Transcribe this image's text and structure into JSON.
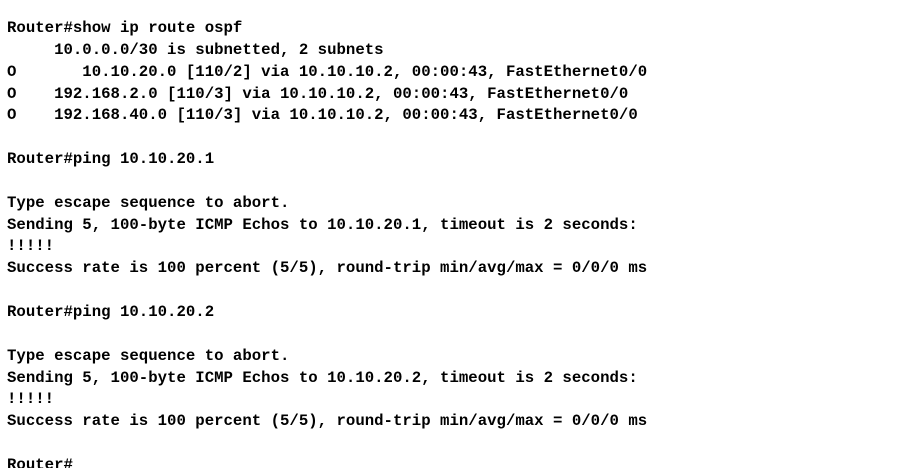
{
  "terminal": {
    "lines": [
      "Router#show ip route ospf",
      "     10.0.0.0/30 is subnetted, 2 subnets",
      "O       10.10.20.0 [110/2] via 10.10.10.2, 00:00:43, FastEthernet0/0",
      "O    192.168.2.0 [110/3] via 10.10.10.2, 00:00:43, FastEthernet0/0",
      "O    192.168.40.0 [110/3] via 10.10.10.2, 00:00:43, FastEthernet0/0",
      "",
      "Router#ping 10.10.20.1",
      "",
      "Type escape sequence to abort.",
      "Sending 5, 100-byte ICMP Echos to 10.10.20.1, timeout is 2 seconds:",
      "!!!!!",
      "Success rate is 100 percent (5/5), round-trip min/avg/max = 0/0/0 ms",
      "",
      "Router#ping 10.10.20.2",
      "",
      "Type escape sequence to abort.",
      "Sending 5, 100-byte ICMP Echos to 10.10.20.2, timeout is 2 seconds:",
      "!!!!!",
      "Success rate is 100 percent (5/5), round-trip min/avg/max = 0/0/0 ms",
      "",
      "Router#"
    ]
  }
}
